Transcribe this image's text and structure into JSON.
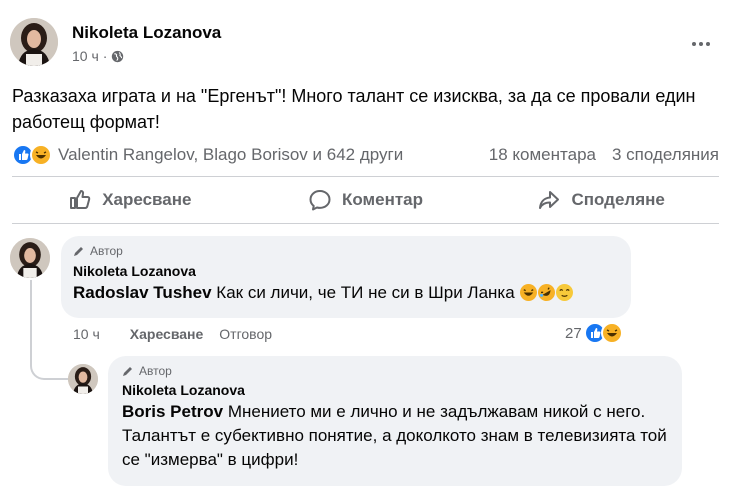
{
  "post": {
    "author": "Nikoleta Lozanova",
    "time": "10 ч",
    "privacy_icon": "globe-icon",
    "text": "Разказаха играта и на \"Ергенът\"! Много талант се изисква, за да се провали един работещ формат!",
    "reactors": "Valentin Rangelov, Blago Borisov и 642 други",
    "comments_count": "18 коментара",
    "shares_count": "3 споделяния",
    "reaction_icons": [
      "like-icon",
      "haha-icon"
    ]
  },
  "actions": {
    "like": "Харесване",
    "comment": "Коментар",
    "share": "Споделяне"
  },
  "comments": [
    {
      "badge": "Автор",
      "author": "Nikoleta Lozanova",
      "mention": "Radoslav Tushev",
      "text": " Как си личи, че ТИ не си в Шри Ланка ",
      "emojis": [
        "laughing-icon",
        "rofl-icon",
        "relieved-icon"
      ],
      "time": "10 ч",
      "like_label": "Харесване",
      "reply_label": "Отговор",
      "reaction_count": "27"
    },
    {
      "badge": "Автор",
      "author": "Nikoleta Lozanova",
      "mention": "Boris Petrov",
      "text": " Мнението ми е лично и не задължавам никой с него. Талантът е субективно понятие, а доколкото знам в телевизията той се \"измерва\" в цифри!"
    }
  ],
  "colors": {
    "secondary_text": "#65676b",
    "bubble_bg": "#f0f2f5",
    "like_blue": "#1877f2",
    "haha_yellow": "#f7b125",
    "divider": "#ced0d4"
  }
}
